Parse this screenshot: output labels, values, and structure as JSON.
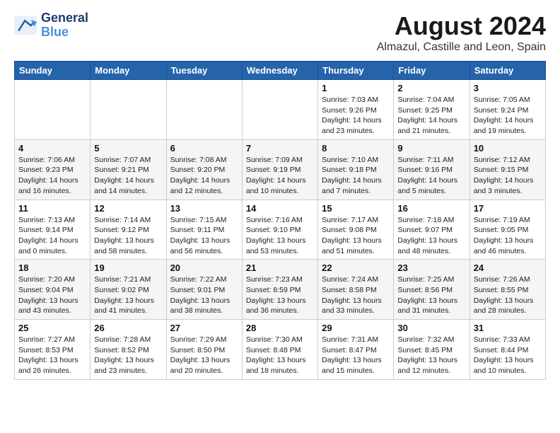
{
  "logo": {
    "line1": "General",
    "line2": "Blue"
  },
  "title": "August 2024",
  "subtitle": "Almazul, Castille and Leon, Spain",
  "days_of_week": [
    "Sunday",
    "Monday",
    "Tuesday",
    "Wednesday",
    "Thursday",
    "Friday",
    "Saturday"
  ],
  "weeks": [
    [
      {
        "day": "",
        "info": ""
      },
      {
        "day": "",
        "info": ""
      },
      {
        "day": "",
        "info": ""
      },
      {
        "day": "",
        "info": ""
      },
      {
        "day": "1",
        "info": "Sunrise: 7:03 AM\nSunset: 9:26 PM\nDaylight: 14 hours\nand 23 minutes."
      },
      {
        "day": "2",
        "info": "Sunrise: 7:04 AM\nSunset: 9:25 PM\nDaylight: 14 hours\nand 21 minutes."
      },
      {
        "day": "3",
        "info": "Sunrise: 7:05 AM\nSunset: 9:24 PM\nDaylight: 14 hours\nand 19 minutes."
      }
    ],
    [
      {
        "day": "4",
        "info": "Sunrise: 7:06 AM\nSunset: 9:23 PM\nDaylight: 14 hours\nand 16 minutes."
      },
      {
        "day": "5",
        "info": "Sunrise: 7:07 AM\nSunset: 9:21 PM\nDaylight: 14 hours\nand 14 minutes."
      },
      {
        "day": "6",
        "info": "Sunrise: 7:08 AM\nSunset: 9:20 PM\nDaylight: 14 hours\nand 12 minutes."
      },
      {
        "day": "7",
        "info": "Sunrise: 7:09 AM\nSunset: 9:19 PM\nDaylight: 14 hours\nand 10 minutes."
      },
      {
        "day": "8",
        "info": "Sunrise: 7:10 AM\nSunset: 9:18 PM\nDaylight: 14 hours\nand 7 minutes."
      },
      {
        "day": "9",
        "info": "Sunrise: 7:11 AM\nSunset: 9:16 PM\nDaylight: 14 hours\nand 5 minutes."
      },
      {
        "day": "10",
        "info": "Sunrise: 7:12 AM\nSunset: 9:15 PM\nDaylight: 14 hours\nand 3 minutes."
      }
    ],
    [
      {
        "day": "11",
        "info": "Sunrise: 7:13 AM\nSunset: 9:14 PM\nDaylight: 14 hours\nand 0 minutes."
      },
      {
        "day": "12",
        "info": "Sunrise: 7:14 AM\nSunset: 9:12 PM\nDaylight: 13 hours\nand 58 minutes."
      },
      {
        "day": "13",
        "info": "Sunrise: 7:15 AM\nSunset: 9:11 PM\nDaylight: 13 hours\nand 56 minutes."
      },
      {
        "day": "14",
        "info": "Sunrise: 7:16 AM\nSunset: 9:10 PM\nDaylight: 13 hours\nand 53 minutes."
      },
      {
        "day": "15",
        "info": "Sunrise: 7:17 AM\nSunset: 9:08 PM\nDaylight: 13 hours\nand 51 minutes."
      },
      {
        "day": "16",
        "info": "Sunrise: 7:18 AM\nSunset: 9:07 PM\nDaylight: 13 hours\nand 48 minutes."
      },
      {
        "day": "17",
        "info": "Sunrise: 7:19 AM\nSunset: 9:05 PM\nDaylight: 13 hours\nand 46 minutes."
      }
    ],
    [
      {
        "day": "18",
        "info": "Sunrise: 7:20 AM\nSunset: 9:04 PM\nDaylight: 13 hours\nand 43 minutes."
      },
      {
        "day": "19",
        "info": "Sunrise: 7:21 AM\nSunset: 9:02 PM\nDaylight: 13 hours\nand 41 minutes."
      },
      {
        "day": "20",
        "info": "Sunrise: 7:22 AM\nSunset: 9:01 PM\nDaylight: 13 hours\nand 38 minutes."
      },
      {
        "day": "21",
        "info": "Sunrise: 7:23 AM\nSunset: 8:59 PM\nDaylight: 13 hours\nand 36 minutes."
      },
      {
        "day": "22",
        "info": "Sunrise: 7:24 AM\nSunset: 8:58 PM\nDaylight: 13 hours\nand 33 minutes."
      },
      {
        "day": "23",
        "info": "Sunrise: 7:25 AM\nSunset: 8:56 PM\nDaylight: 13 hours\nand 31 minutes."
      },
      {
        "day": "24",
        "info": "Sunrise: 7:26 AM\nSunset: 8:55 PM\nDaylight: 13 hours\nand 28 minutes."
      }
    ],
    [
      {
        "day": "25",
        "info": "Sunrise: 7:27 AM\nSunset: 8:53 PM\nDaylight: 13 hours\nand 26 minutes."
      },
      {
        "day": "26",
        "info": "Sunrise: 7:28 AM\nSunset: 8:52 PM\nDaylight: 13 hours\nand 23 minutes."
      },
      {
        "day": "27",
        "info": "Sunrise: 7:29 AM\nSunset: 8:50 PM\nDaylight: 13 hours\nand 20 minutes."
      },
      {
        "day": "28",
        "info": "Sunrise: 7:30 AM\nSunset: 8:48 PM\nDaylight: 13 hours\nand 18 minutes."
      },
      {
        "day": "29",
        "info": "Sunrise: 7:31 AM\nSunset: 8:47 PM\nDaylight: 13 hours\nand 15 minutes."
      },
      {
        "day": "30",
        "info": "Sunrise: 7:32 AM\nSunset: 8:45 PM\nDaylight: 13 hours\nand 12 minutes."
      },
      {
        "day": "31",
        "info": "Sunrise: 7:33 AM\nSunset: 8:44 PM\nDaylight: 13 hours\nand 10 minutes."
      }
    ]
  ]
}
